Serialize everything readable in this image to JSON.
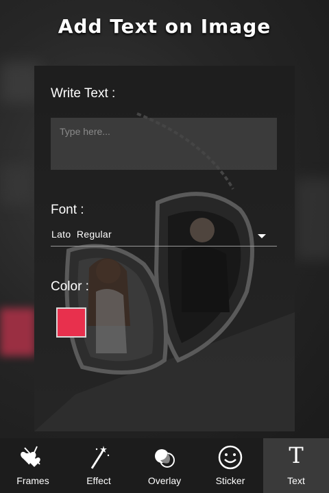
{
  "header": {
    "title": "Add Text on Image"
  },
  "form": {
    "write_text_label": "Write Text :",
    "text_placeholder": "Type here...",
    "text_value": "",
    "font_label": "Font :",
    "font_value": "Lato  Regular",
    "color_label": "Color :",
    "selected_color": "#e8304d"
  },
  "nav": {
    "items": [
      {
        "label": "Frames",
        "icon": "hearts-icon"
      },
      {
        "label": "Effect",
        "icon": "magic-wand-icon"
      },
      {
        "label": "Overlay",
        "icon": "overlay-circles-icon"
      },
      {
        "label": "Sticker",
        "icon": "smiley-icon"
      },
      {
        "label": "Text",
        "icon": "text-T-icon",
        "active": true
      }
    ]
  }
}
